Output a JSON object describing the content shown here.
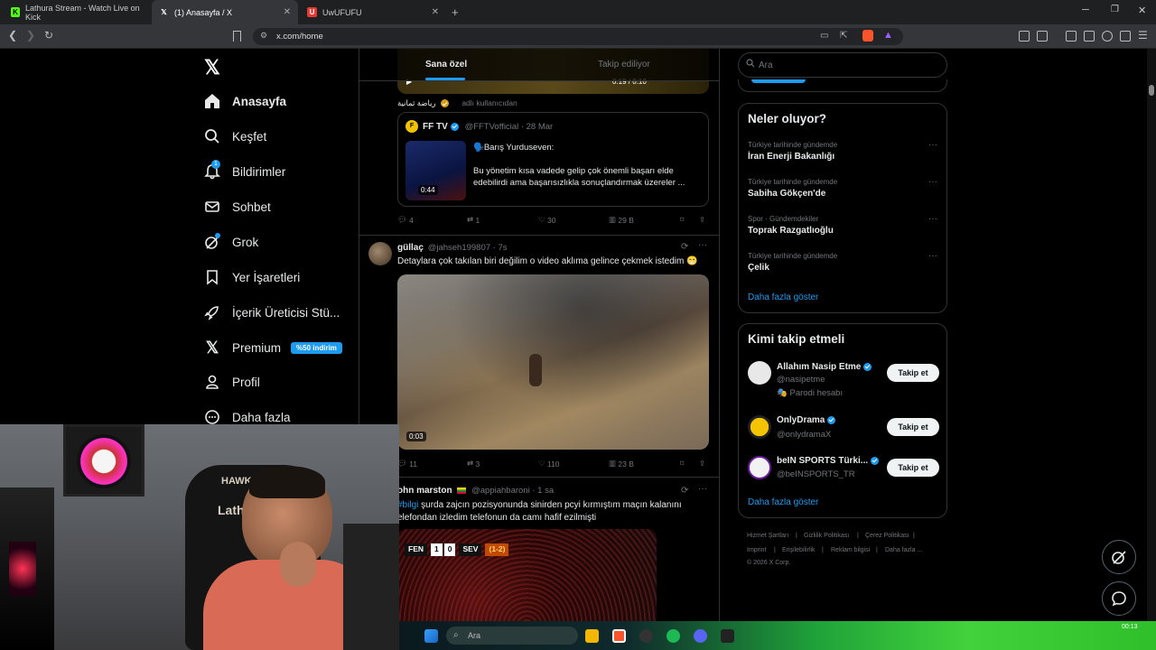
{
  "browser": {
    "tabs": [
      {
        "title": "Lathura Stream - Watch Live on Kick",
        "icon": "kick-icon",
        "color": "#53fc18"
      },
      {
        "title": "(1) Anasayfa / X",
        "icon": "x-icon",
        "color": "#ffffff"
      },
      {
        "title": "UwUFUFU",
        "icon": "uwufufu-icon",
        "color": "#e53935"
      }
    ],
    "url": "x.com/home"
  },
  "nav": {
    "items": [
      {
        "label": "Anasayfa",
        "icon": "home-icon"
      },
      {
        "label": "Keşfet",
        "icon": "search-icon"
      },
      {
        "label": "Bildirimler",
        "icon": "bell-icon",
        "badge": "1"
      },
      {
        "label": "Sohbet",
        "icon": "mail-icon"
      },
      {
        "label": "Grok",
        "icon": "grok-icon"
      },
      {
        "label": "Yer İşaretleri",
        "icon": "bookmark-icon"
      },
      {
        "label": "İçerik Üreticisi Stü...",
        "icon": "rocket-icon"
      },
      {
        "label": "Premium",
        "icon": "x-icon",
        "badge": "%50 indirim"
      },
      {
        "label": "Profil",
        "icon": "person-icon"
      },
      {
        "label": "Daha fazla",
        "icon": "more-circle-icon"
      }
    ]
  },
  "feed": {
    "tabs": [
      "Sana özel",
      "Takip ediliyor"
    ],
    "video_time": "0:19 / 0:10",
    "retweet_by": "رياضة ثمانية",
    "retweet_suffix": "adlı kullanıcıdan",
    "quote": {
      "name": "FF TV",
      "handle": "@FFTVofficial · 28 Mar",
      "lead": "🗣️Barış Yurduseven:",
      "text": "Bu yönetim kısa vadede gelip çok önemli başarı elde edebilirdi ama başarısızlıkla sonuçlandırmak üzereler ...",
      "duration": "0:44"
    },
    "tweet1_actions": {
      "reply": "4",
      "retweet": "1",
      "like": "30",
      "views": "29 B"
    },
    "tweet2": {
      "name": "güllaç",
      "handle": "@jahseh199807 · 7s",
      "text": "Detaylara çok takılan biri değilim o video aklıma gelince çekmek istedim 😁",
      "duration": "0:03",
      "actions": {
        "reply": "11",
        "retweet": "3",
        "like": "110",
        "views": "23 B"
      }
    },
    "tweet3": {
      "name": "ohn marston",
      "handle": "@appiahbaroni · 1 sa",
      "hashtag": "#bilgi",
      "text": "şurda zajcın pozisyonunda sinirden pcyi kırmıştım maçın kalanını",
      "text2": "elefondan izledim telefonun da camı hafif ezilmişti",
      "score": {
        "home": "FEN",
        "home_score": "1",
        "away_score": "0",
        "away": "SEV",
        "agg": "(1-2)"
      }
    }
  },
  "right": {
    "search_placeholder": "Ara",
    "trends_title": "Neler oluyor?",
    "trends": [
      {
        "category": "Türkiye tarihinde gündemde",
        "name": "İran Enerji Bakanlığı"
      },
      {
        "category": "Türkiye tarihinde gündemde",
        "name": "Sabiha Gökçen'de"
      },
      {
        "category": "Spor · Gündemdekiler",
        "name": "Toprak Razgatlıoğlu"
      },
      {
        "category": "Türkiye tarihinde gündemde",
        "name": "Çelik"
      }
    ],
    "show_more": "Daha fazla göster",
    "who_title": "Kimi takip etmeli",
    "who": [
      {
        "name": "Allahım Nasip Etme",
        "handle": "@nasipetme",
        "extra": "Parodi hesabı",
        "button": "Takip et"
      },
      {
        "name": "OnlyDrama",
        "handle": "@onlydramaX",
        "extra": "",
        "button": "Takip et"
      },
      {
        "name": "beIN SPORTS Türki...",
        "handle": "@beINSPORTS_TR",
        "extra": "",
        "button": "Takip et"
      }
    ],
    "who_more": "Daha fazla göster",
    "footer": [
      "Hizmet Şartları",
      "Gizlilik Politikası",
      "Çerez Politikası",
      "Imprint",
      "Erişilebilirlik",
      "Reklam bilgisi",
      "Daha fazla ...",
      "© 2026 X Corp."
    ]
  },
  "webcam": {
    "chair_brand": "HAWK",
    "chair_name": "Lathura"
  },
  "taskbar": {
    "search_placeholder": "Ara",
    "time": "00:13"
  }
}
